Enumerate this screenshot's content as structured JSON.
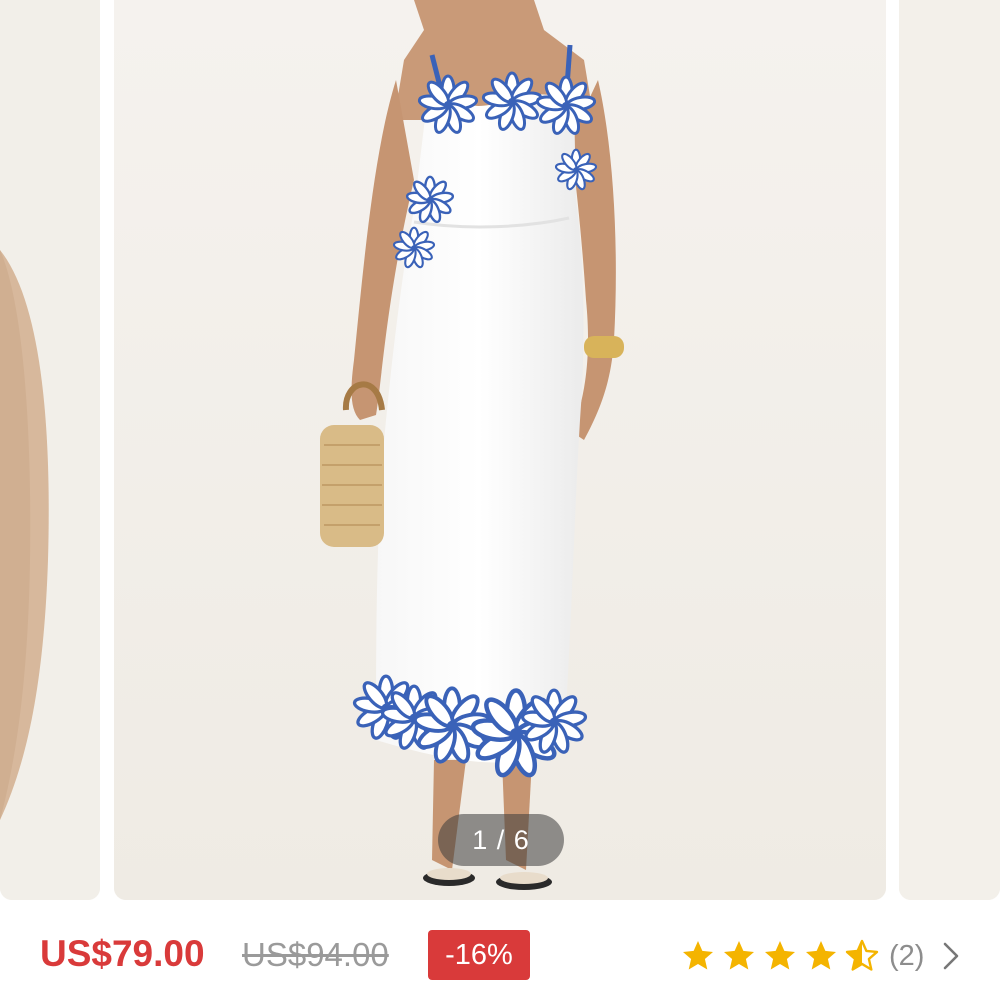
{
  "gallery": {
    "current_index": 1,
    "total": 6,
    "counter_text": "1 / 6"
  },
  "pricing": {
    "current_price": "US$79.00",
    "original_price": "US$94.00",
    "discount": "-16%",
    "accent_color": "#d93a3a"
  },
  "rating": {
    "stars": 4.5,
    "max_stars": 5,
    "review_count_text": "(2)",
    "star_color": "#f4b400"
  },
  "icons": {
    "star": "star-icon",
    "half_star": "half-star-icon",
    "chevron": "chevron-right-icon"
  }
}
